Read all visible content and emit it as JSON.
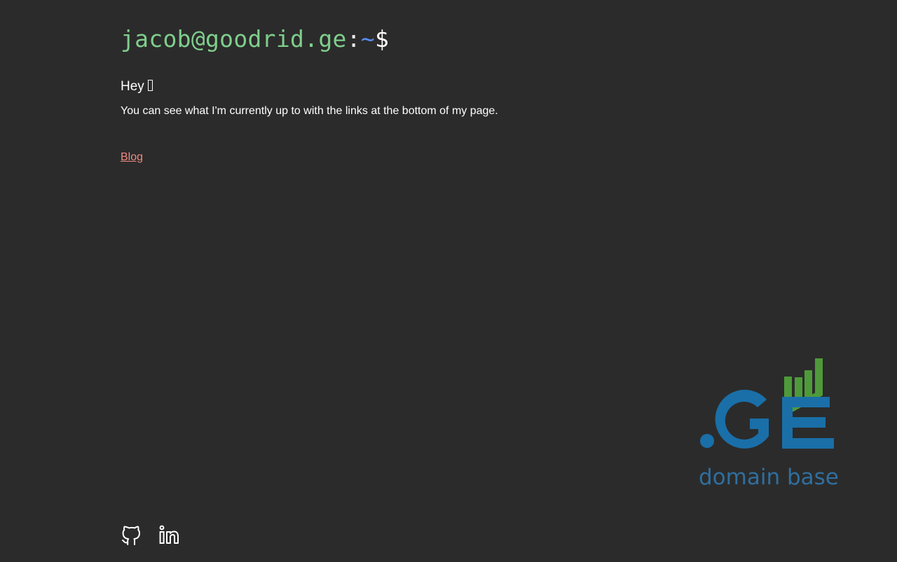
{
  "header": {
    "user_host": "jacob@goodrid.ge",
    "colon": ":",
    "path": "~",
    "prompt_symbol": "$"
  },
  "main": {
    "greeting": "Hey",
    "intro": "You can see what I'm currently up to with the links at the bottom of my page.",
    "blog_link": "Blog"
  },
  "badge": {
    "logo_text": ".GE",
    "caption": "domain base"
  },
  "footer": {
    "icons": [
      "github-icon",
      "linkedin-icon"
    ]
  },
  "colors": {
    "background": "#2b2b2b",
    "user_host": "#7fce8c",
    "path": "#5b8df0",
    "link": "#ef8a80",
    "logo_blue": "#1a6fa8",
    "logo_green": "#4e9a3a",
    "caption_blue": "#2f6f9f"
  }
}
